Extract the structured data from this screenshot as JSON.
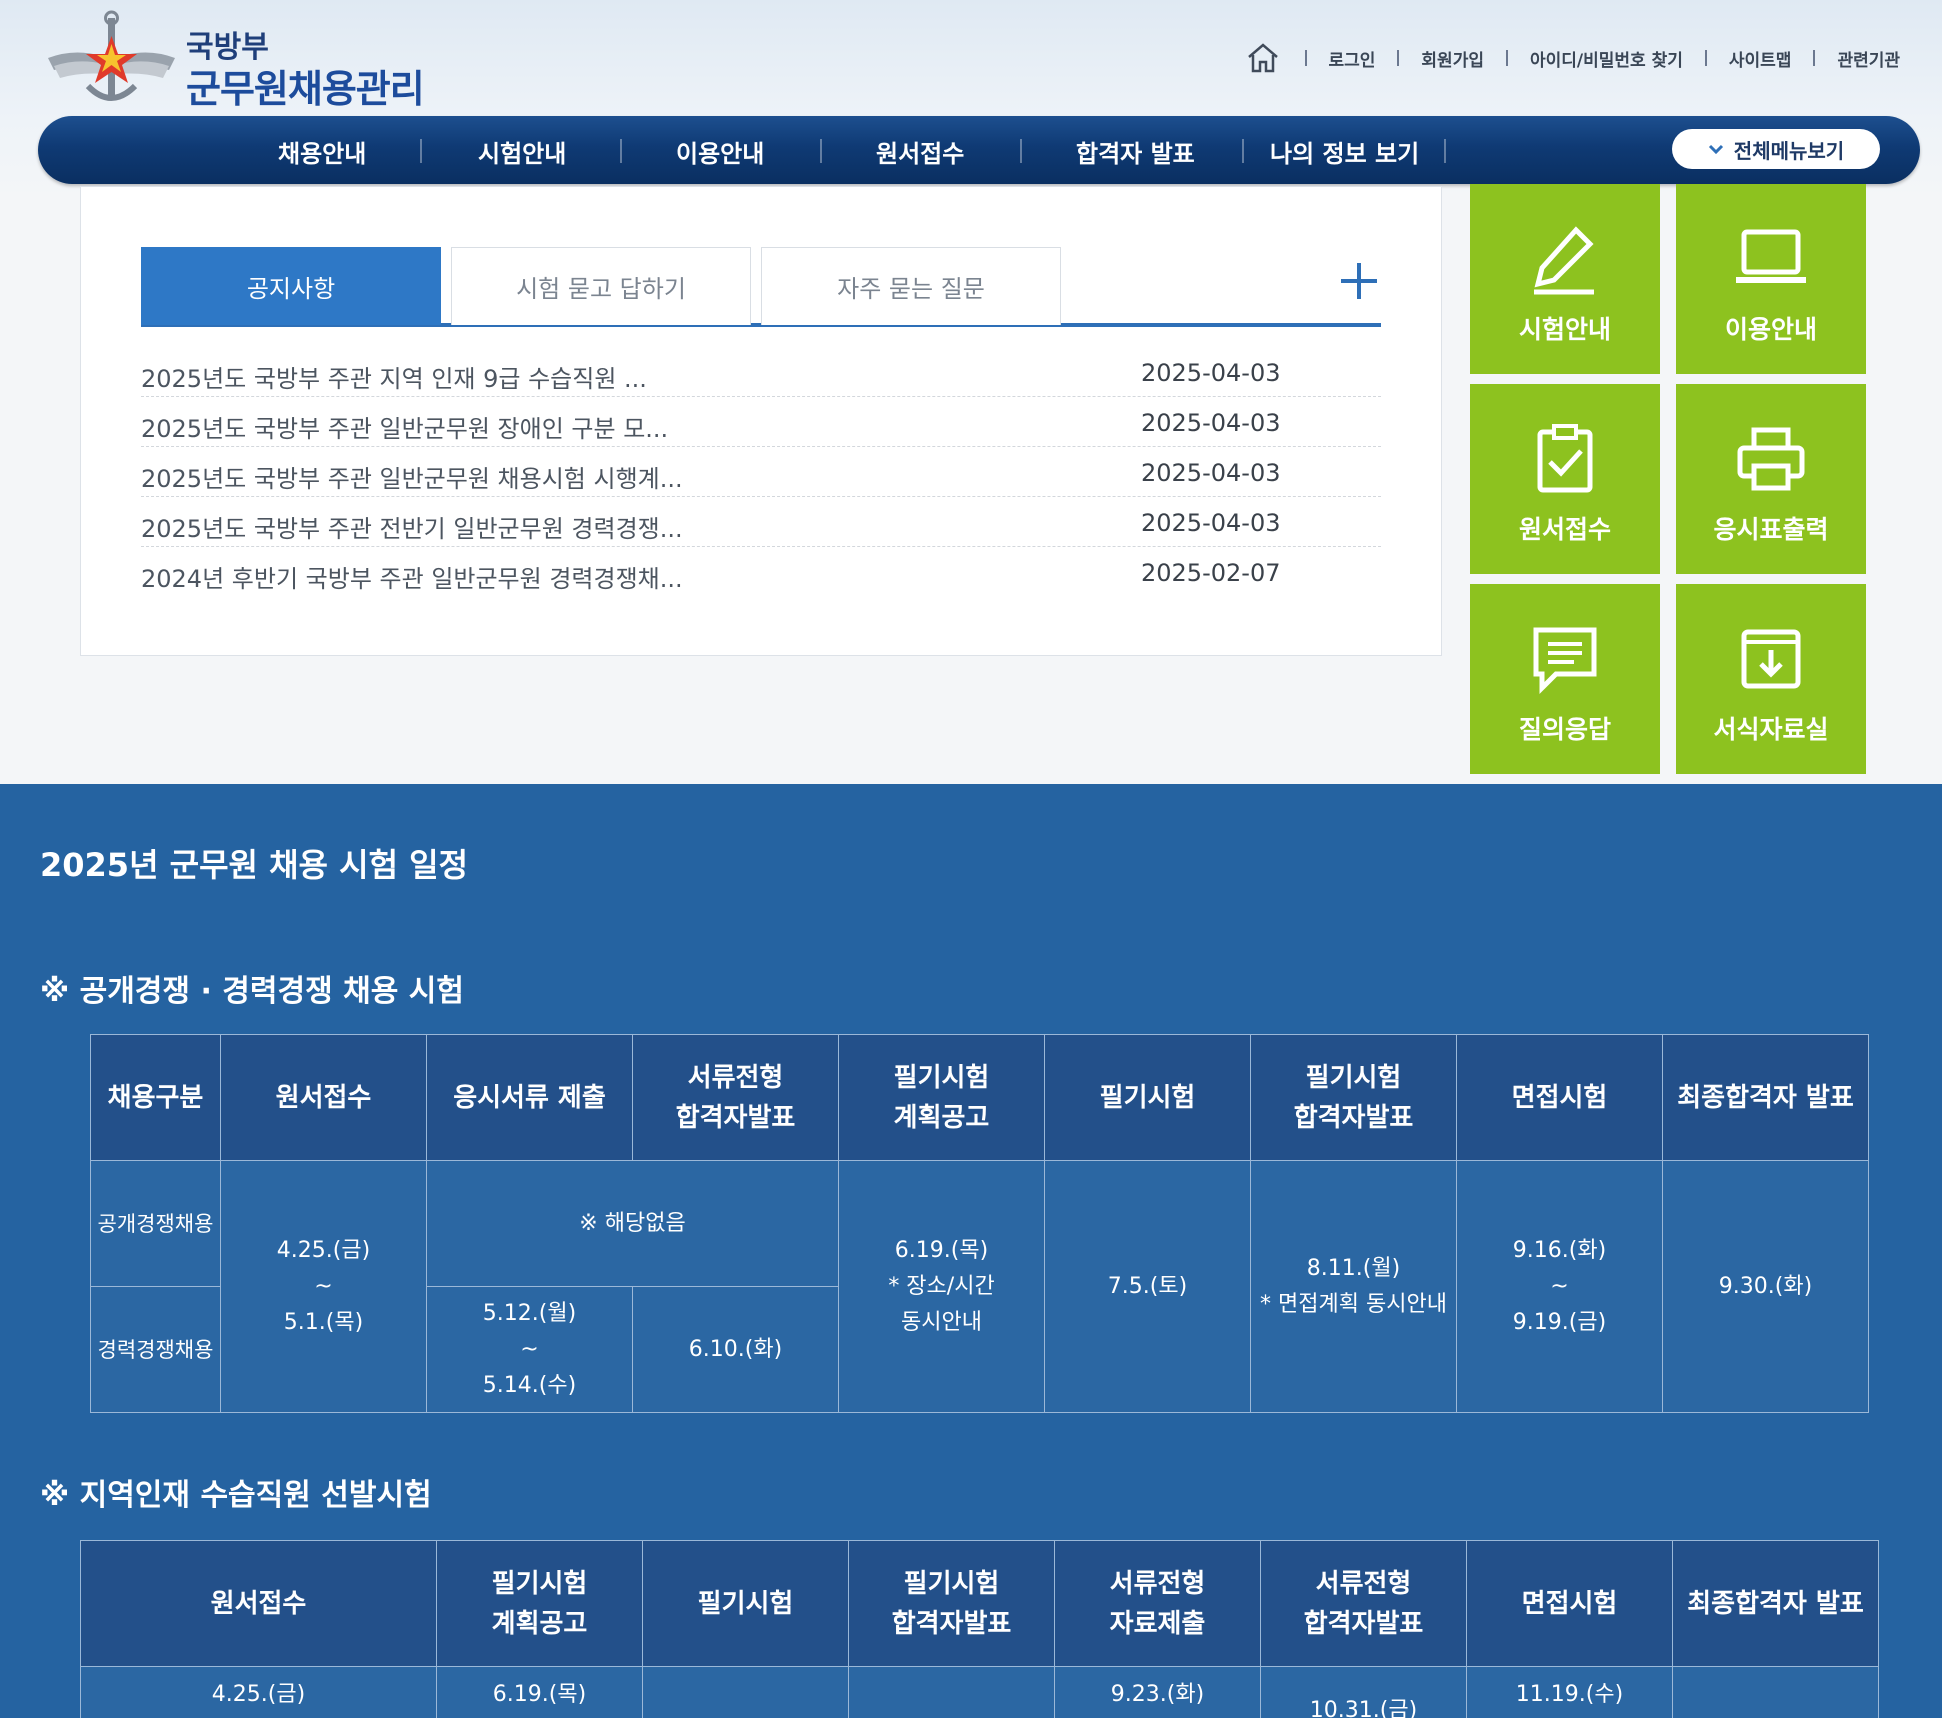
{
  "logo": {
    "sub": "국방부",
    "main": "군무원채용관리"
  },
  "topnav": [
    "로그인",
    "회원가입",
    "아이디/비밀번호 찾기",
    "사이트맵",
    "관련기관"
  ],
  "mainnav": {
    "items": [
      "채용안내",
      "시험안내",
      "이용안내",
      "원서접수",
      "합격자 발표",
      "나의 정보 보기"
    ],
    "all_menu": "전체메뉴보기"
  },
  "notice": {
    "tabs": [
      "공지사항",
      "시험 묻고 답하기",
      "자주 묻는 질문"
    ],
    "items": [
      {
        "title": "2025년도 국방부 주관 지역 인재 9급 수습직원 ...",
        "date": "2025-04-03"
      },
      {
        "title": "2025년도 국방부 주관 일반군무원 장애인 구분 모...",
        "date": "2025-04-03"
      },
      {
        "title": "2025년도 국방부 주관 일반군무원 채용시험 시행계...",
        "date": "2025-04-03"
      },
      {
        "title": "2025년도 국방부 주관 전반기 일반군무원 경력경쟁...",
        "date": "2025-04-03"
      },
      {
        "title": "2024년 후반기 국방부 주관 일반군무원 경력경쟁채...",
        "date": "2025-02-07"
      }
    ]
  },
  "tiles": [
    {
      "label": "시험안내",
      "icon": "pencil-icon"
    },
    {
      "label": "이용안내",
      "icon": "laptop-icon"
    },
    {
      "label": "원서접수",
      "icon": "clipboard-check-icon"
    },
    {
      "label": "응시표출력",
      "icon": "printer-icon"
    },
    {
      "label": "질의응답",
      "icon": "chat-list-icon"
    },
    {
      "label": "서식자료실",
      "icon": "download-box-icon"
    }
  ],
  "colors": {
    "nav": "#0f3a74",
    "tab_active": "#2e78c6",
    "tile": "#8dc21f",
    "schedule_bg": "#2563a1"
  },
  "schedule": {
    "title": "2025년 군무원 채용 시험 일정",
    "section1": {
      "title": "※ 공개경쟁 · 경력경쟁 채용 시험",
      "headers": [
        "채용구분",
        "원서접수",
        "응시서류 제출",
        "서류전형\n합격자발표",
        "필기시험\n계획공고",
        "필기시험",
        "필기시험\n합격자발표",
        "면접시험",
        "최종합격자 발표"
      ],
      "row1_label": "공개경쟁채용",
      "row2_label": "경력경쟁채용",
      "apply": [
        "4.25.(금)",
        "~",
        "5.1.(목)"
      ],
      "na": "※ 해당없음",
      "docs_submit": [
        "5.12.(월)",
        "~",
        "5.14.(수)"
      ],
      "docs_result": "6.10.(화)",
      "written_plan": [
        "6.19.(목)",
        "* 장소/시간",
        "동시안내"
      ],
      "written": "7.5.(토)",
      "written_result": [
        "8.11.(월)",
        "* 면접계획 동시안내"
      ],
      "interview": [
        "9.16.(화)",
        "~",
        "9.19.(금)"
      ],
      "final": "9.30.(화)"
    },
    "section2": {
      "title": "※ 지역인재 수습직원 선발시험",
      "headers": [
        "원서접수",
        "필기시험\n계획공고",
        "필기시험",
        "필기시험\n합격자발표",
        "서류전형\n자료제출",
        "서류전형\n합격자발표",
        "면접시험",
        "최종합격자 발표"
      ],
      "row": [
        "4.25.(금)",
        "6.19.(목)",
        "",
        "",
        "9.23.(화)",
        "10.31.(금)",
        "11.19.(수)",
        ""
      ]
    }
  }
}
